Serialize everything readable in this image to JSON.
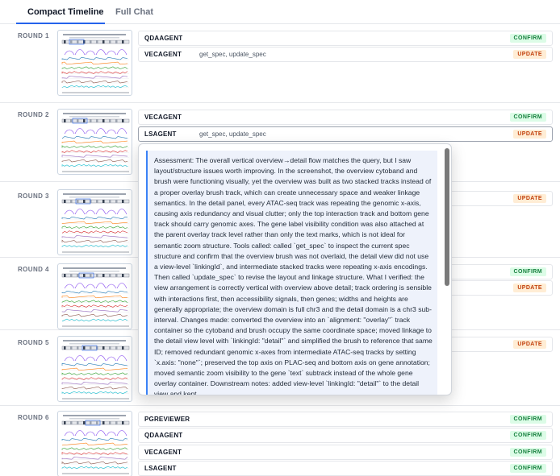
{
  "tabs": [
    {
      "label": "Compact Timeline",
      "active": true
    },
    {
      "label": "Full Chat",
      "active": false
    }
  ],
  "rounds": [
    {
      "label": "ROUND 1",
      "agents": [
        {
          "name": "QDAAGENT",
          "tools": "",
          "status": "CONFIRM"
        },
        {
          "name": "VECAGENT",
          "tools": "get_spec, update_spec",
          "status": "UPDATE"
        }
      ]
    },
    {
      "label": "ROUND 2",
      "agents": [
        {
          "name": "VECAGENT",
          "tools": "",
          "status": "CONFIRM"
        },
        {
          "name": "LSAGENT",
          "tools": "get_spec, update_spec",
          "status": "UPDATE"
        }
      ]
    },
    {
      "label": "ROUND 3",
      "agents": [
        {
          "name": "",
          "tools": "",
          "status": "UPDATE"
        }
      ]
    },
    {
      "label": "ROUND 4",
      "agents": [
        {
          "name": "",
          "tools": "",
          "status": "CONFIRM"
        },
        {
          "name": "",
          "tools": "",
          "status": "UPDATE"
        }
      ]
    },
    {
      "label": "ROUND 5",
      "agents": [
        {
          "name": "",
          "tools": "",
          "status": "UPDATE"
        }
      ]
    },
    {
      "label": "ROUND 6",
      "agents": [
        {
          "name": "PGREVIEWER",
          "tools": "",
          "status": "CONFIRM"
        },
        {
          "name": "QDAAGENT",
          "tools": "",
          "status": "CONFIRM"
        },
        {
          "name": "VECAGENT",
          "tools": "",
          "status": "CONFIRM"
        },
        {
          "name": "LSAGENT",
          "tools": "",
          "status": "CONFIRM"
        }
      ]
    }
  ],
  "popup": {
    "text": "Assessment: The overall vertical overview→detail flow matches the query, but I saw layout/structure issues worth improving. In the screenshot, the overview cytoband and brush were functioning visually, yet the overview was built as two stacked tracks instead of a proper overlay brush track, which can create unnecessary space and weaker linkage semantics. In the detail panel, every ATAC-seq track was repeating the genomic x-axis, causing axis redundancy and visual clutter; only the top interaction track and bottom gene track should carry genomic axes. The gene label visibility condition was also attached at the parent overlay track level rather than only the text marks, which is not ideal for semantic zoom structure. Tools called: called `get_spec` to inspect the current spec structure and confirm that the overview brush was not overlaid, the detail view did not use a view-level `linkingId`, and intermediate stacked tracks were repeating x-axis encodings. Then called `update_spec` to revise the layout and linkage structure. What I verified: the view arrangement is correctly vertical with overview above detail; track ordering is sensible with interactions first, then accessibility signals, then genes; widths and heights are generally appropriate; the overview domain is full chr3 and the detail domain is a chr3 sub-interval. Changes made: converted the overview into an `alignment: \"overlay\"` track container so the cytoband and brush occupy the same coordinate space; moved linkage to the detail view level with `linkingId: \"detail\"` and simplified the brush to reference that same ID; removed redundant genomic x-axes from intermediate ATAC-seq tracks by setting `x.axis: \"none\"`; preserved the top axis on PLAC-seq and bottom axis on gene annotation; moved semantic zoom visibility to the gene `text` subtrack instead of the whole gene overlay container. Downstream notes: added view-level `linkingId: \"detail\"` to the detail view and kept"
  },
  "colors": {
    "accent": "#2563eb",
    "confirm_text": "#15803d",
    "confirm_bg": "#dcfce7",
    "update_text": "#c2410c",
    "update_bg": "#ffedd5",
    "popup_bg": "#eef2fb",
    "popup_border": "#3b82f6"
  }
}
